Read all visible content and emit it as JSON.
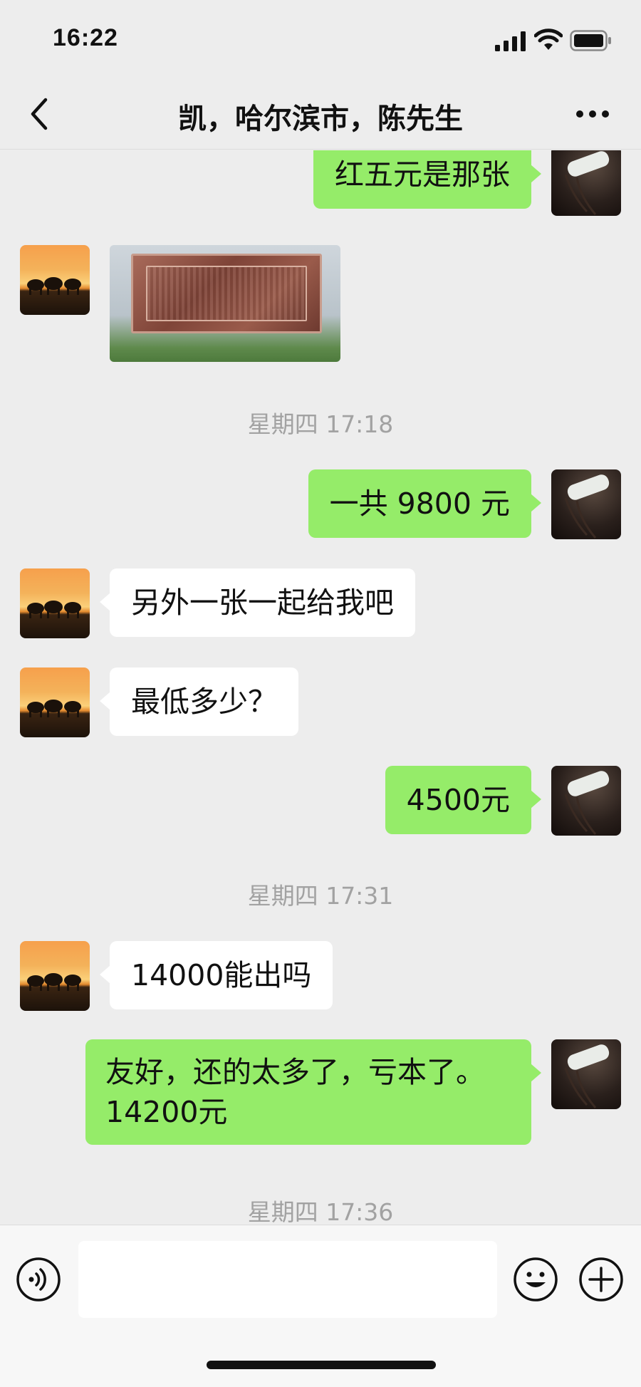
{
  "status_bar": {
    "time": "16:22"
  },
  "header": {
    "title": "凯，哈尔滨市，陈先生"
  },
  "messages": [
    {
      "text": "红五元是那张"
    },
    {
      "text": "一共 9800 元"
    },
    {
      "text": "另外一张一起给我吧"
    },
    {
      "text": "最低多少？"
    },
    {
      "text": "4500元"
    },
    {
      "text": "14000能出吗"
    },
    {
      "line1": "友好，还的太多了，亏本了。",
      "line2": "14200元"
    }
  ],
  "timestamps": [
    "星期四 17:18",
    "星期四 17:31",
    "星期四 17:36"
  ],
  "colors": {
    "outgoing_bubble": "#95ec69",
    "incoming_bubble": "#ffffff",
    "background": "#ededed",
    "timestamp_text": "#a2a2a2"
  },
  "icons": {
    "back": "chevron-left-icon",
    "more": "more-dots-icon",
    "voice": "voice-icon",
    "emoji": "emoji-icon",
    "add": "plus-circle-icon"
  }
}
